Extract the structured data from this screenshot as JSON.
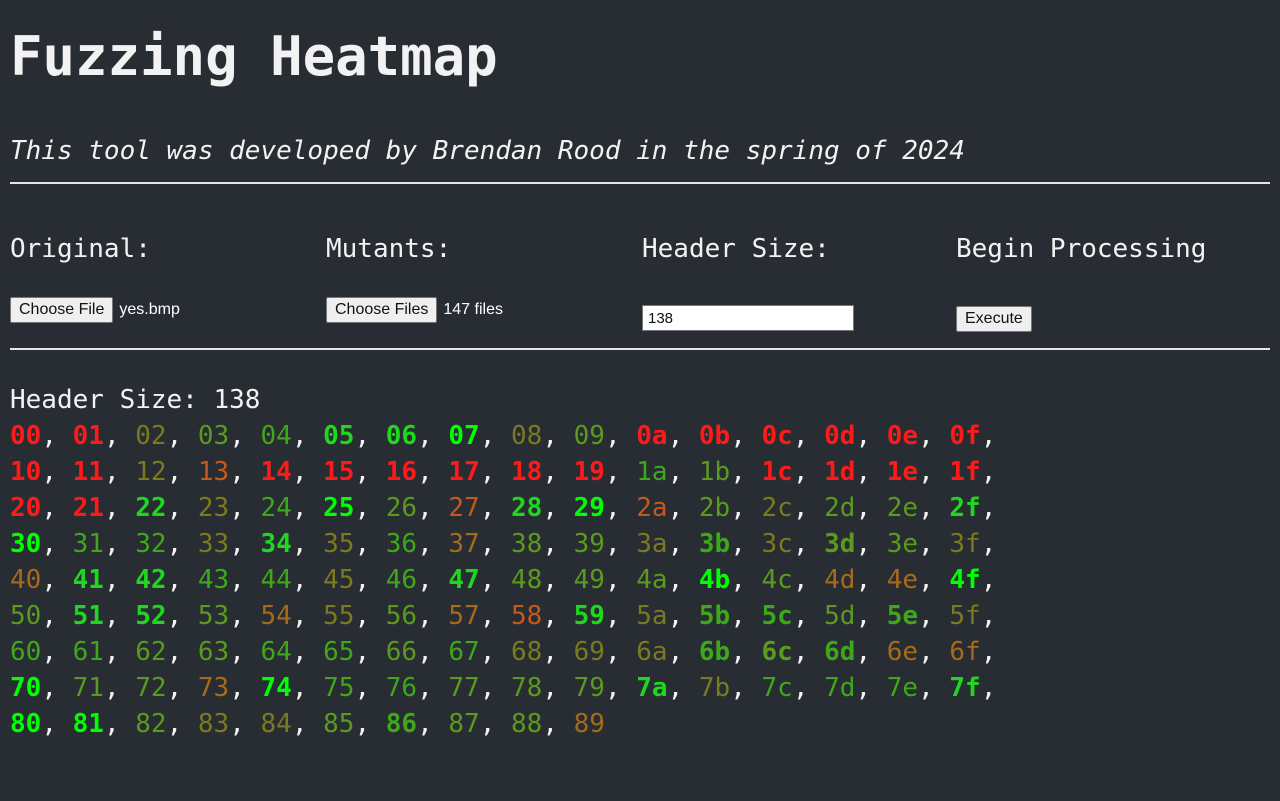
{
  "title": "Fuzzing Heatmap",
  "subtitle": "This tool was developed by Brendan Rood in the spring of 2024",
  "controls": {
    "original": {
      "label": "Original:",
      "button": "Choose File",
      "file": "yes.bmp"
    },
    "mutants": {
      "label": "Mutants:",
      "button": "Choose Files",
      "file": "147 files"
    },
    "header": {
      "label": "Header Size:",
      "value": "138"
    },
    "process": {
      "label": "Begin Processing",
      "button": "Execute"
    }
  },
  "result": {
    "header_line": "Header Size: 138"
  },
  "colors": {
    "background": "#282c33",
    "R": "#ff1a1a",
    "O": "#c4591a",
    "B": "#a66a1a",
    "Y": "#7a7a1e",
    "L": "#5a9a1e",
    "M": "#3ea81a",
    "G": "#1fd71f",
    "W": "#00ff00"
  },
  "heatmap": {
    "separator": ", ",
    "rows": [
      {
        "bytes": [
          "00",
          "01",
          "02",
          "03",
          "04",
          "05",
          "06",
          "07",
          "08",
          "09",
          "0a",
          "0b",
          "0c",
          "0d",
          "0e",
          "0f"
        ],
        "heat": "RRYLMGGWYLRRRRRR",
        "bold": "1100011100111111"
      },
      {
        "bytes": [
          "10",
          "11",
          "12",
          "13",
          "14",
          "15",
          "16",
          "17",
          "18",
          "19",
          "1a",
          "1b",
          "1c",
          "1d",
          "1e",
          "1f"
        ],
        "heat": "RRYORRRRRRMLRRRR",
        "bold": "1100111111001111"
      },
      {
        "bytes": [
          "20",
          "21",
          "22",
          "23",
          "24",
          "25",
          "26",
          "27",
          "28",
          "29",
          "2a",
          "2b",
          "2c",
          "2d",
          "2e",
          "2f"
        ],
        "heat": "RRGYMWLOGWOLYLLG",
        "bold": "1110010011000001"
      },
      {
        "bytes": [
          "30",
          "31",
          "32",
          "33",
          "34",
          "35",
          "36",
          "37",
          "38",
          "39",
          "3a",
          "3b",
          "3c",
          "3d",
          "3e",
          "3f"
        ],
        "heat": "WMMYGYMBLLYMYLLY",
        "bold": "1000100000010100"
      },
      {
        "bytes": [
          "40",
          "41",
          "42",
          "43",
          "44",
          "45",
          "46",
          "47",
          "48",
          "49",
          "4a",
          "4b",
          "4c",
          "4d",
          "4e",
          "4f"
        ],
        "heat": "BGGMMYMGLLLWLBBW",
        "bold": "0110000100010001"
      },
      {
        "bytes": [
          "50",
          "51",
          "52",
          "53",
          "54",
          "55",
          "56",
          "57",
          "58",
          "59",
          "5a",
          "5b",
          "5c",
          "5d",
          "5e",
          "5f"
        ],
        "heat": "LGGLBYLBOGYMMLMY",
        "bold": "0110000001011010"
      },
      {
        "bytes": [
          "60",
          "61",
          "62",
          "63",
          "64",
          "65",
          "66",
          "67",
          "68",
          "69",
          "6a",
          "6b",
          "6c",
          "6d",
          "6e",
          "6f"
        ],
        "heat": "MMLLMMLMYYYMLMBB",
        "bold": "0000000000011100"
      },
      {
        "bytes": [
          "70",
          "71",
          "72",
          "73",
          "74",
          "75",
          "76",
          "77",
          "78",
          "79",
          "7a",
          "7b",
          "7c",
          "7d",
          "7e",
          "7f"
        ],
        "heat": "WLLBWMMLLLGYMMMG",
        "bold": "1000100000100001"
      },
      {
        "bytes": [
          "80",
          "81",
          "82",
          "83",
          "84",
          "85",
          "86",
          "87",
          "88",
          "89"
        ],
        "heat": "WWLYYLMLLB",
        "bold": "1100001000"
      }
    ]
  }
}
